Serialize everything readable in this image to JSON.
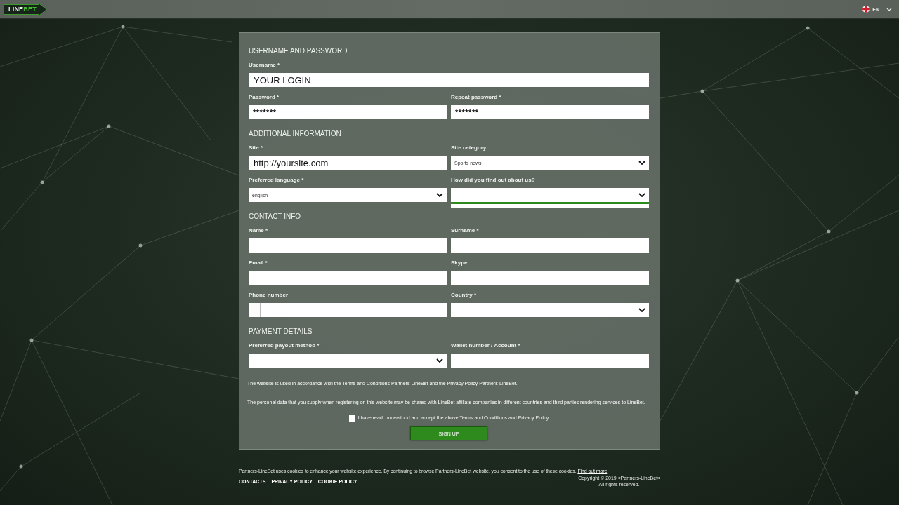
{
  "top_bar": {
    "logo": {
      "text": "LINE",
      "accent_text": "BET"
    },
    "language": {
      "code": "EN"
    }
  },
  "form": {
    "sections": [
      {
        "title": "USERNAME AND PASSWORD",
        "rows": [
          {
            "fields": [
              {
                "label": "Username *",
                "kind": "text",
                "value": "YOUR LOGIN"
              }
            ]
          },
          {
            "fields": [
              {
                "label": "Password *",
                "kind": "password",
                "value": "*******"
              },
              {
                "label": "Repeat password *",
                "kind": "password",
                "value": "*******"
              }
            ]
          }
        ]
      },
      {
        "title": "ADDITIONAL INFORMATION",
        "rows": [
          {
            "fields": [
              {
                "label": "Site *",
                "kind": "text",
                "value": "http://yoursite.com"
              },
              {
                "label": "Site category",
                "kind": "select",
                "value": "Sports news",
                "expanded": false
              }
            ]
          },
          {
            "fields": [
              {
                "label": "Preferred language *",
                "kind": "select",
                "value": "english",
                "expanded": false
              },
              {
                "label": "How did you find out about us?",
                "kind": "select",
                "expanded": true
              }
            ]
          }
        ]
      },
      {
        "title": "CONTACT INFO",
        "rows": [
          {
            "fields": [
              {
                "label": "Name *",
                "kind": "text"
              },
              {
                "label": "Surname *",
                "kind": "text"
              }
            ]
          },
          {
            "fields": [
              {
                "label": "Email *",
                "kind": "text"
              },
              {
                "label": "Skype",
                "kind": "text"
              }
            ]
          },
          {
            "fields": [
              {
                "label": "Phone number",
                "kind": "phone"
              },
              {
                "label": "Country *",
                "kind": "select",
                "expanded": false
              }
            ]
          }
        ]
      },
      {
        "title": "PAYMENT DETAILS",
        "rows": [
          {
            "fields": [
              {
                "label": "Preferred payout method *",
                "kind": "select",
                "expanded": false
              },
              {
                "label": "Wallet number / Account *",
                "kind": "text"
              }
            ]
          }
        ]
      }
    ],
    "terms_notice": [
      {
        "text": "The website is used in accordance with the ",
        "link": false
      },
      {
        "text": "Terms and Conditions Partners-LineBet",
        "link": true
      },
      {
        "text": " and the ",
        "link": false
      },
      {
        "text": "Privacy Policy Partners-LineBet",
        "link": true
      },
      {
        "text": ".",
        "link": false
      }
    ],
    "data_notice": "The personal data that you supply when registering on this website may be shared with LineBet affiliate companies in different countries and third parties rendering services to LineBet.",
    "consent": {
      "label": "I have read, understood and accept the above Terms and Conditions and Privacy Policy",
      "checked": false
    },
    "submit": {
      "label": "SIGN UP"
    }
  },
  "footer": {
    "cookie_notice": {
      "text": "Partners-LineBet uses cookies to enhance your website experience. By continuing to browse Partners-LineBet website, you consent to the use of these cookies.",
      "link": "Find out more"
    },
    "links": [
      "CONTACTS",
      "PRIVACY POLICY",
      "COOKIE POLICY"
    ],
    "copyright": [
      "Copyright © 2019 «Partners-LineBet»",
      "All rights reserved."
    ]
  }
}
